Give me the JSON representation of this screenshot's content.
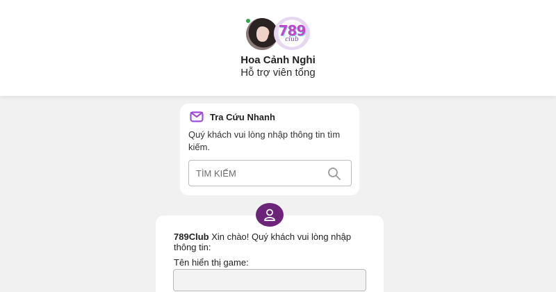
{
  "header": {
    "agent_name": "Hoa Cảnh Nghi",
    "agent_role": "Hỗ trợ viên tổng",
    "logo_number": "789",
    "logo_text": "club",
    "online_status_color": "#2ea84d"
  },
  "lookup": {
    "icon": "mail-box-icon",
    "title": "Tra Cứu Nhanh",
    "description": "Quý khách vui lòng nhập thông tin tìm kiếm.",
    "search_placeholder": "TÌM KIẾM",
    "search_icon": "search-icon"
  },
  "form": {
    "avatar_icon": "user-icon",
    "brand": "789Club",
    "greeting": " Xin chào! Quý khách vui lòng nhập thông tin:",
    "name_label": "Tên hiển thị game:",
    "name_value": ""
  },
  "colors": {
    "accent": "#6b2478",
    "icon_purple": "#9b4fd6",
    "background": "#f2f1f2"
  }
}
